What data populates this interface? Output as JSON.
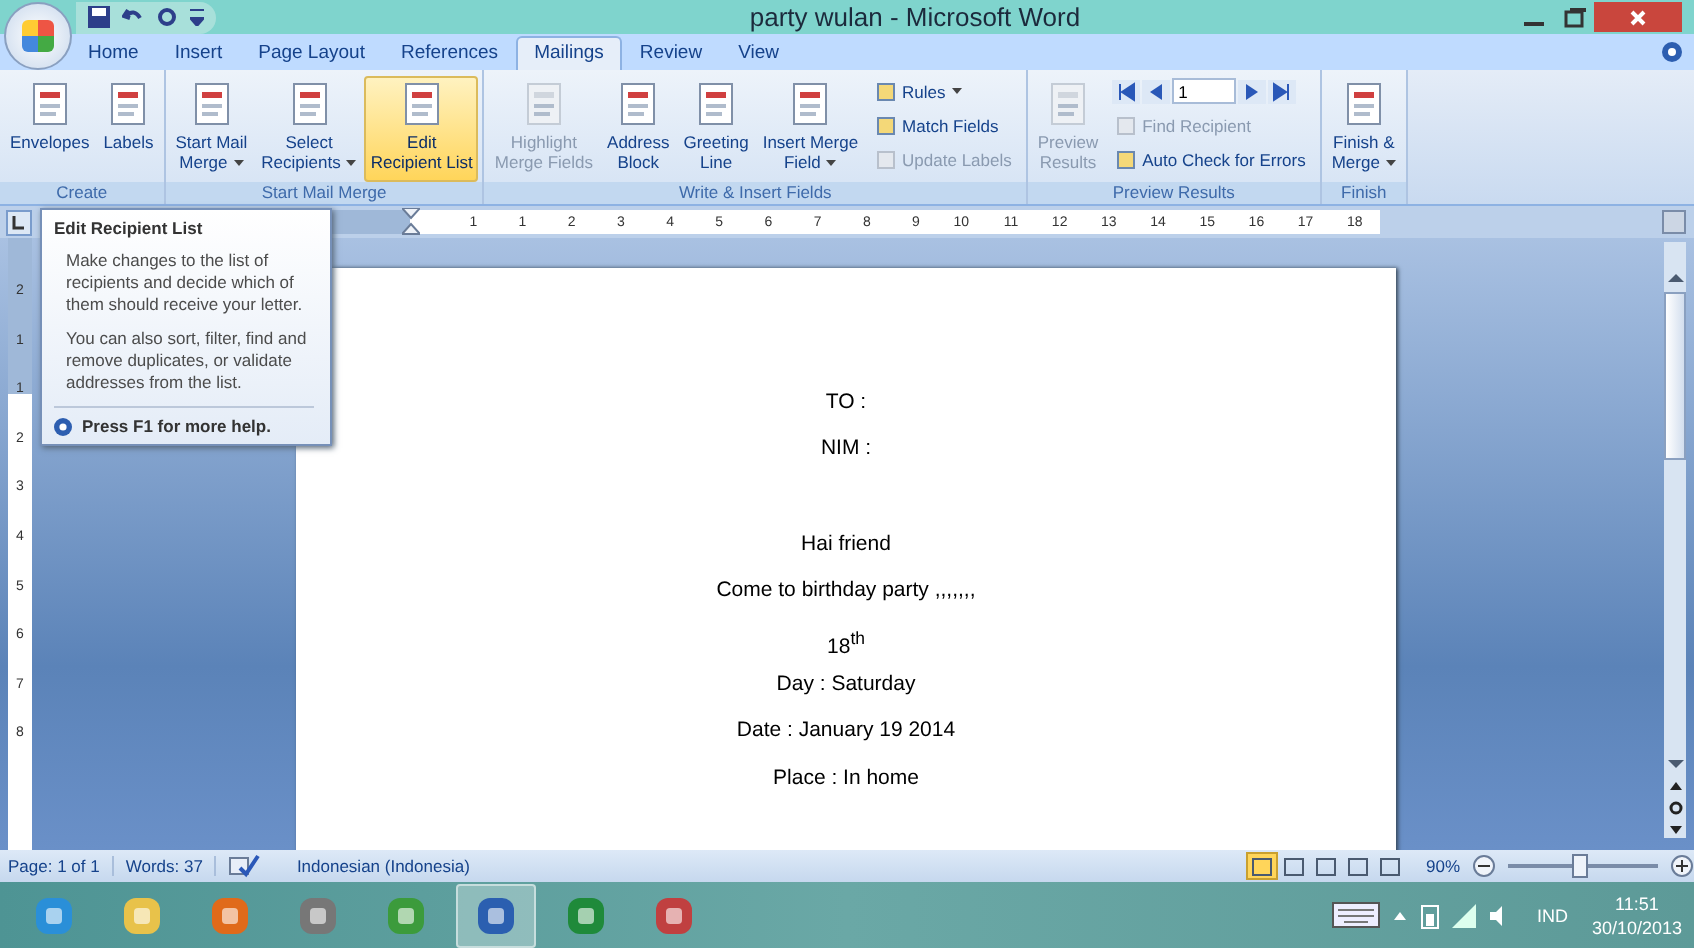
{
  "window": {
    "title": "party wulan - Microsoft Word"
  },
  "tabs": [
    {
      "label": "Home",
      "selected": false
    },
    {
      "label": "Insert",
      "selected": false
    },
    {
      "label": "Page Layout",
      "selected": false
    },
    {
      "label": "References",
      "selected": false
    },
    {
      "label": "Mailings",
      "selected": true
    },
    {
      "label": "Review",
      "selected": false
    },
    {
      "label": "View",
      "selected": false
    }
  ],
  "ribbon": {
    "groups": [
      {
        "name": "Create",
        "buttons": [
          {
            "kind": "large",
            "lines": [
              "Envelopes"
            ],
            "disabled": false,
            "highlighted": false,
            "dropdown": false
          },
          {
            "kind": "large",
            "lines": [
              "Labels"
            ],
            "disabled": false,
            "highlighted": false,
            "dropdown": false
          }
        ]
      },
      {
        "name": "Start Mail Merge",
        "buttons": [
          {
            "kind": "large",
            "lines": [
              "Start Mail",
              "Merge"
            ],
            "disabled": false,
            "highlighted": false,
            "dropdown": true
          },
          {
            "kind": "large",
            "lines": [
              "Select",
              "Recipients"
            ],
            "disabled": false,
            "highlighted": false,
            "dropdown": true
          },
          {
            "kind": "large",
            "lines": [
              "Edit",
              "Recipient List"
            ],
            "disabled": false,
            "highlighted": true,
            "dropdown": false
          }
        ]
      },
      {
        "name": "Write & Insert Fields",
        "buttons": [
          {
            "kind": "large",
            "lines": [
              "Highlight",
              "Merge Fields"
            ],
            "disabled": true,
            "highlighted": false,
            "dropdown": false
          },
          {
            "kind": "large",
            "lines": [
              "Address",
              "Block"
            ],
            "disabled": false,
            "highlighted": false,
            "dropdown": false
          },
          {
            "kind": "large",
            "lines": [
              "Greeting",
              "Line"
            ],
            "disabled": false,
            "highlighted": false,
            "dropdown": false
          },
          {
            "kind": "large",
            "lines": [
              "Insert Merge",
              "Field"
            ],
            "disabled": false,
            "highlighted": false,
            "dropdown": true
          },
          {
            "kind": "small",
            "lines": [
              "Rules"
            ],
            "disabled": false,
            "highlighted": false,
            "dropdown": true
          },
          {
            "kind": "small",
            "lines": [
              "Match Fields"
            ],
            "disabled": false,
            "highlighted": false,
            "dropdown": false
          },
          {
            "kind": "small",
            "lines": [
              "Update Labels"
            ],
            "disabled": true,
            "highlighted": false,
            "dropdown": false
          }
        ]
      },
      {
        "name": "Preview Results",
        "buttons": [
          {
            "kind": "large",
            "lines": [
              "Preview",
              "Results"
            ],
            "disabled": true,
            "highlighted": false,
            "dropdown": false
          },
          {
            "kind": "small",
            "lines": [
              "Find Recipient"
            ],
            "disabled": true,
            "highlighted": false,
            "dropdown": false
          },
          {
            "kind": "small",
            "lines": [
              "Auto Check for Errors"
            ],
            "disabled": false,
            "highlighted": false,
            "dropdown": false
          }
        ],
        "record_field": {
          "value": "1"
        }
      },
      {
        "name": "Finish",
        "buttons": [
          {
            "kind": "large",
            "lines": [
              "Finish &",
              "Merge"
            ],
            "disabled": false,
            "highlighted": false,
            "dropdown": true
          }
        ]
      }
    ]
  },
  "tooltip": {
    "title": "Edit Recipient List",
    "paragraphs": [
      "Make changes to the list of recipients and decide which of them should receive your letter.",
      "You can also sort, filter, find and remove duplicates, or validate addresses from the list."
    ],
    "help": "Press F1 for more help."
  },
  "ruler": {
    "labels": [
      "1",
      "1",
      "2",
      "3",
      "4",
      "5",
      "6",
      "7",
      "8",
      "9",
      "10",
      "11",
      "12",
      "13",
      "14",
      "15",
      "16",
      "17",
      "18"
    ]
  },
  "vertical_ruler": {
    "labels": [
      "2",
      "1",
      "1",
      "2",
      "3",
      "4",
      "5",
      "6",
      "7",
      "8"
    ]
  },
  "document": {
    "address_lines": [
      "TO :",
      "NIM :"
    ],
    "body_lines": [
      "Hai friend",
      "Come to birthday party ,,,,,,,",
      "18$^{th}$",
      "Day : Saturday",
      "Date : January 19 2014",
      "Place : In home"
    ]
  },
  "status_bar": {
    "page": "Page: 1 of 1",
    "words": "Words: 37",
    "language": "Indonesian (Indonesia)",
    "views": [
      {
        "selected": true
      },
      {
        "selected": false
      },
      {
        "selected": false
      },
      {
        "selected": false
      },
      {
        "selected": false
      }
    ],
    "zoom": "90%",
    "zoom_slider": {
      "level": 0.47
    }
  },
  "taskbar": {
    "apps": [
      {
        "selected": false
      },
      {
        "selected": false
      },
      {
        "selected": false
      },
      {
        "selected": false
      },
      {
        "selected": false
      },
      {
        "selected": true
      },
      {
        "selected": false
      },
      {
        "selected": false
      }
    ],
    "language": "IND",
    "time": "11:51",
    "date": "30/10/2013"
  }
}
